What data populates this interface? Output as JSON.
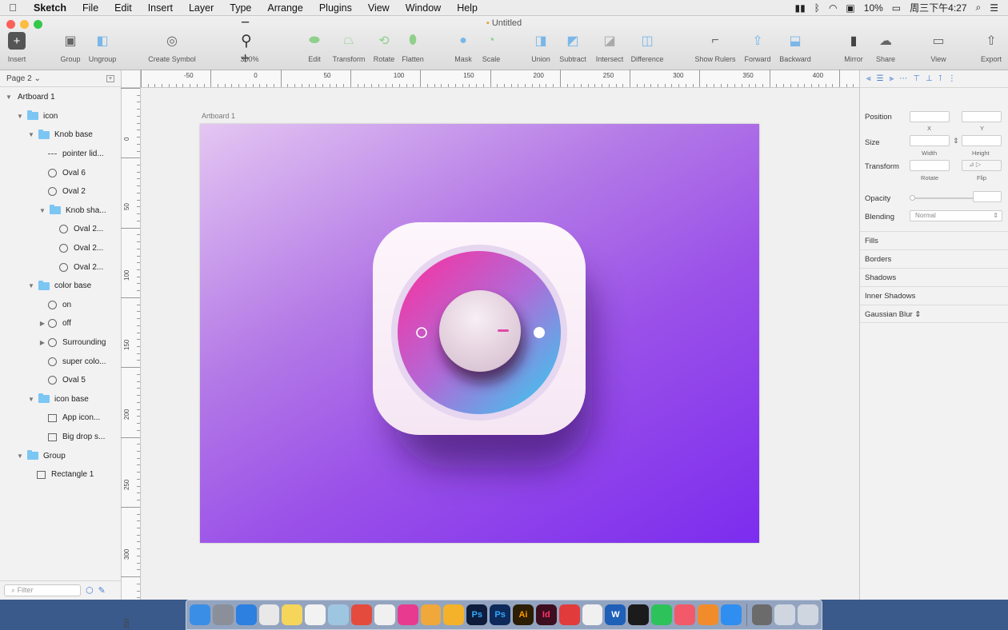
{
  "menubar": {
    "items": [
      "Sketch",
      "File",
      "Edit",
      "Insert",
      "Layer",
      "Type",
      "Arrange",
      "Plugins",
      "View",
      "Window",
      "Help"
    ],
    "battery": "10%",
    "clock": "周三下午4:27"
  },
  "window": {
    "title": "Untitled"
  },
  "toolbar": {
    "insert": "Insert",
    "group": "Group",
    "ungroup": "Ungroup",
    "create_symbol": "Create Symbol",
    "zoom": "300%",
    "edit": "Edit",
    "transform": "Transform",
    "rotate": "Rotate",
    "flatten": "Flatten",
    "mask": "Mask",
    "scale": "Scale",
    "union": "Union",
    "subtract": "Subtract",
    "intersect": "Intersect",
    "difference": "Difference",
    "show_rulers": "Show Rulers",
    "forward": "Forward",
    "backward": "Backward",
    "mirror": "Mirror",
    "share": "Share",
    "view": "View",
    "export": "Export"
  },
  "sidebar": {
    "page": "Page 2",
    "filter_placeholder": "Filter",
    "layers": [
      {
        "label": "Artboard 1",
        "indent": 0,
        "icon": "none",
        "arrow": "down"
      },
      {
        "label": "icon",
        "indent": 1,
        "icon": "folder",
        "arrow": "down"
      },
      {
        "label": "Knob base",
        "indent": 2,
        "icon": "folder",
        "arrow": "down"
      },
      {
        "label": "pointer lid...",
        "indent": 3,
        "icon": "line",
        "arrow": ""
      },
      {
        "label": "Oval 6",
        "indent": 3,
        "icon": "circle",
        "arrow": ""
      },
      {
        "label": "Oval 2",
        "indent": 3,
        "icon": "circle",
        "arrow": ""
      },
      {
        "label": "Knob sha...",
        "indent": 3,
        "icon": "folder",
        "arrow": "down"
      },
      {
        "label": "Oval 2...",
        "indent": 4,
        "icon": "circle",
        "arrow": ""
      },
      {
        "label": "Oval 2...",
        "indent": 4,
        "icon": "circle",
        "arrow": ""
      },
      {
        "label": "Oval 2...",
        "indent": 4,
        "icon": "circle",
        "arrow": ""
      },
      {
        "label": "color base",
        "indent": 2,
        "icon": "folder",
        "arrow": "down"
      },
      {
        "label": "on",
        "indent": 3,
        "icon": "circle",
        "arrow": ""
      },
      {
        "label": "off",
        "indent": 3,
        "icon": "circle",
        "arrow": "right"
      },
      {
        "label": "Surrounding",
        "indent": 3,
        "icon": "circle",
        "arrow": "right"
      },
      {
        "label": "super colo...",
        "indent": 3,
        "icon": "circle",
        "arrow": ""
      },
      {
        "label": "Oval 5",
        "indent": 3,
        "icon": "circle",
        "arrow": ""
      },
      {
        "label": "icon base",
        "indent": 2,
        "icon": "folder",
        "arrow": "down"
      },
      {
        "label": "App icon...",
        "indent": 3,
        "icon": "square",
        "arrow": ""
      },
      {
        "label": "Big drop s...",
        "indent": 3,
        "icon": "square",
        "arrow": ""
      },
      {
        "label": "Group",
        "indent": 1,
        "icon": "folder",
        "arrow": "down"
      },
      {
        "label": "Rectangle 1",
        "indent": 2,
        "icon": "square",
        "arrow": ""
      }
    ]
  },
  "rulers": {
    "top": [
      "-50",
      "0",
      "50",
      "100",
      "150",
      "200",
      "250",
      "300",
      "350",
      "400"
    ],
    "left": [
      "0",
      "50",
      "100",
      "150",
      "200",
      "250",
      "300",
      "350"
    ]
  },
  "canvas": {
    "artboard_label": "Artboard 1"
  },
  "inspector": {
    "position": "Position",
    "x": "X",
    "y": "Y",
    "size": "Size",
    "width": "Width",
    "height": "Height",
    "transform": "Transform",
    "rotate": "Rotate",
    "flip": "Flip",
    "opacity": "Opacity",
    "blending": "Blending",
    "blending_value": "Normal",
    "sections": [
      "Fills",
      "Borders",
      "Shadows",
      "Inner Shadows",
      "Gaussian Blur"
    ]
  },
  "dock": {
    "apps": [
      "Finder",
      "Launchpad",
      "Safari",
      "Calendar",
      "Notes",
      "TextEdit",
      "Preview",
      "Chrome",
      "Photos",
      "Colors",
      "Reeder",
      "Sketch",
      "Ps",
      "Ps",
      "Ai",
      "Id",
      "XMind",
      "Scissors",
      "Word",
      "QQ",
      "WeChat",
      "Music",
      "Books",
      "App Store",
      "Settings",
      "Downloads",
      "Trash"
    ]
  },
  "colors": {
    "artboard_start": "#e4c6f2",
    "artboard_end": "#7c2cee",
    "folder": "#7cc6f4",
    "accent": "#4a7fd4"
  }
}
